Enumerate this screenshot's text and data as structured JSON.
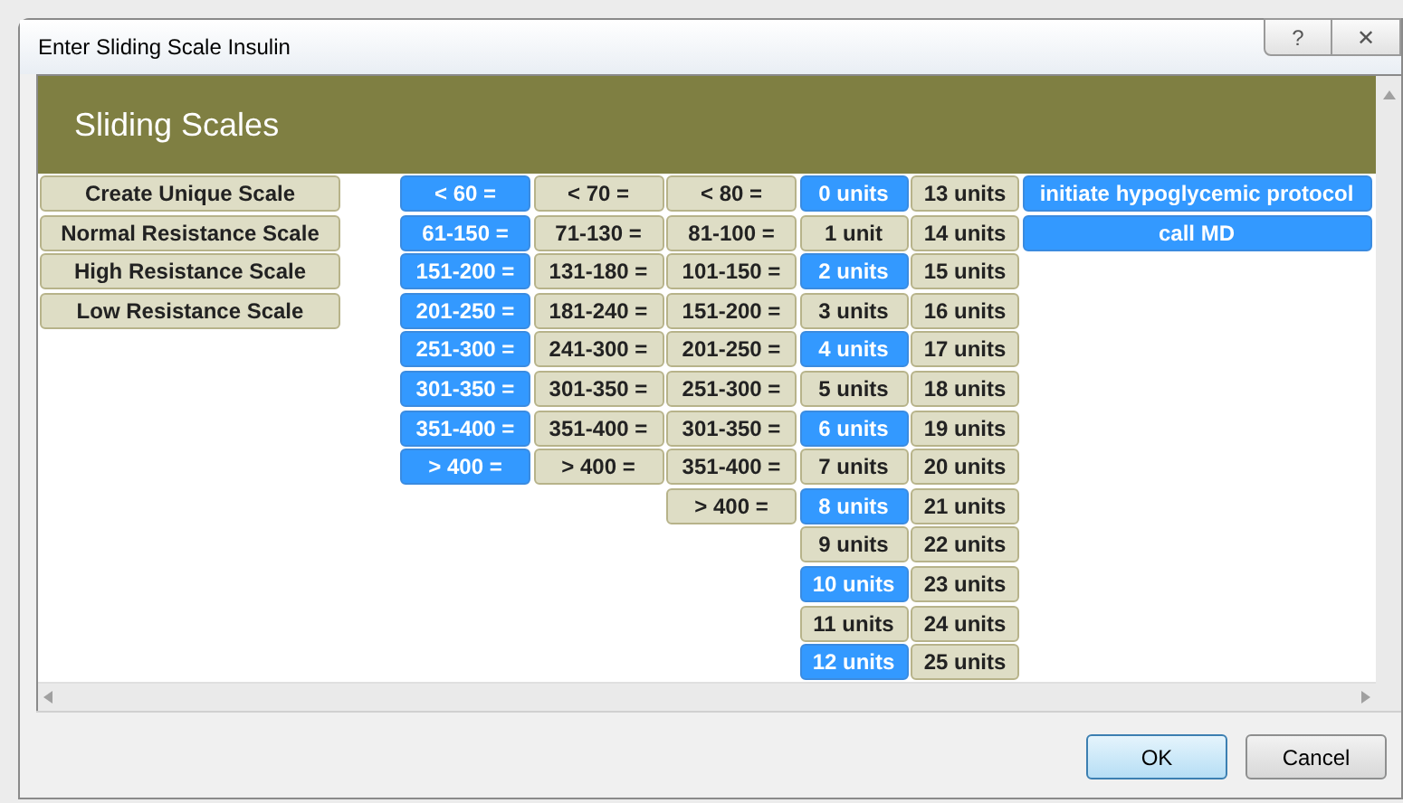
{
  "window": {
    "title": "Enter Sliding Scale Insulin",
    "help": "?",
    "close": "✕"
  },
  "header": {
    "title": "Sliding Scales"
  },
  "scales": [
    {
      "label": "Create Unique Scale",
      "selected": false
    },
    {
      "label": "Normal Resistance Scale",
      "selected": false
    },
    {
      "label": "High Resistance Scale",
      "selected": false
    },
    {
      "label": "Low Resistance Scale",
      "selected": false
    }
  ],
  "columns": [
    {
      "cells": [
        {
          "label": "< 60 =",
          "selected": true
        },
        {
          "label": "61-150 =",
          "selected": true
        },
        {
          "label": "151-200 =",
          "selected": true
        },
        {
          "label": "201-250 =",
          "selected": true
        },
        {
          "label": "251-300 =",
          "selected": true
        },
        {
          "label": "301-350 =",
          "selected": true
        },
        {
          "label": "351-400 =",
          "selected": true
        },
        {
          "label": "> 400 =",
          "selected": true
        }
      ]
    },
    {
      "cells": [
        {
          "label": "< 70 =",
          "selected": false
        },
        {
          "label": "71-130 =",
          "selected": false
        },
        {
          "label": "131-180 =",
          "selected": false
        },
        {
          "label": "181-240 =",
          "selected": false
        },
        {
          "label": "241-300 =",
          "selected": false
        },
        {
          "label": "301-350 =",
          "selected": false
        },
        {
          "label": "351-400 =",
          "selected": false
        },
        {
          "label": "> 400 =",
          "selected": false
        }
      ]
    },
    {
      "cells": [
        {
          "label": "< 80 =",
          "selected": false
        },
        {
          "label": "81-100 =",
          "selected": false
        },
        {
          "label": "101-150 =",
          "selected": false
        },
        {
          "label": "151-200 =",
          "selected": false
        },
        {
          "label": "201-250 =",
          "selected": false
        },
        {
          "label": "251-300 =",
          "selected": false
        },
        {
          "label": "301-350 =",
          "selected": false
        },
        {
          "label": "351-400 =",
          "selected": false
        },
        {
          "label": "> 400 =",
          "selected": false
        }
      ]
    },
    {
      "cells": [
        {
          "label": "0 units",
          "selected": true
        },
        {
          "label": "1 unit",
          "selected": false
        },
        {
          "label": "2 units",
          "selected": true
        },
        {
          "label": "3 units",
          "selected": false
        },
        {
          "label": "4 units",
          "selected": true
        },
        {
          "label": "5 units",
          "selected": false
        },
        {
          "label": "6 units",
          "selected": true
        },
        {
          "label": "7 units",
          "selected": false
        },
        {
          "label": "8 units",
          "selected": true
        },
        {
          "label": "9 units",
          "selected": false
        },
        {
          "label": "10 units",
          "selected": true
        },
        {
          "label": "11 units",
          "selected": false
        },
        {
          "label": "12 units",
          "selected": true
        }
      ]
    },
    {
      "cells": [
        {
          "label": "13 units",
          "selected": false
        },
        {
          "label": "14 units",
          "selected": false
        },
        {
          "label": "15 units",
          "selected": false
        },
        {
          "label": "16 units",
          "selected": false
        },
        {
          "label": "17 units",
          "selected": false
        },
        {
          "label": "18 units",
          "selected": false
        },
        {
          "label": "19 units",
          "selected": false
        },
        {
          "label": "20 units",
          "selected": false
        },
        {
          "label": "21 units",
          "selected": false
        },
        {
          "label": "22 units",
          "selected": false
        },
        {
          "label": "23 units",
          "selected": false
        },
        {
          "label": "24 units",
          "selected": false
        },
        {
          "label": "25 units",
          "selected": false
        }
      ]
    },
    {
      "cells": [
        {
          "label": "initiate hypoglycemic protocol",
          "selected": true
        },
        {
          "label": "call MD",
          "selected": true
        }
      ]
    }
  ],
  "buttons": [
    {
      "label": "OK",
      "default": true
    },
    {
      "label": "Cancel",
      "default": false
    }
  ]
}
